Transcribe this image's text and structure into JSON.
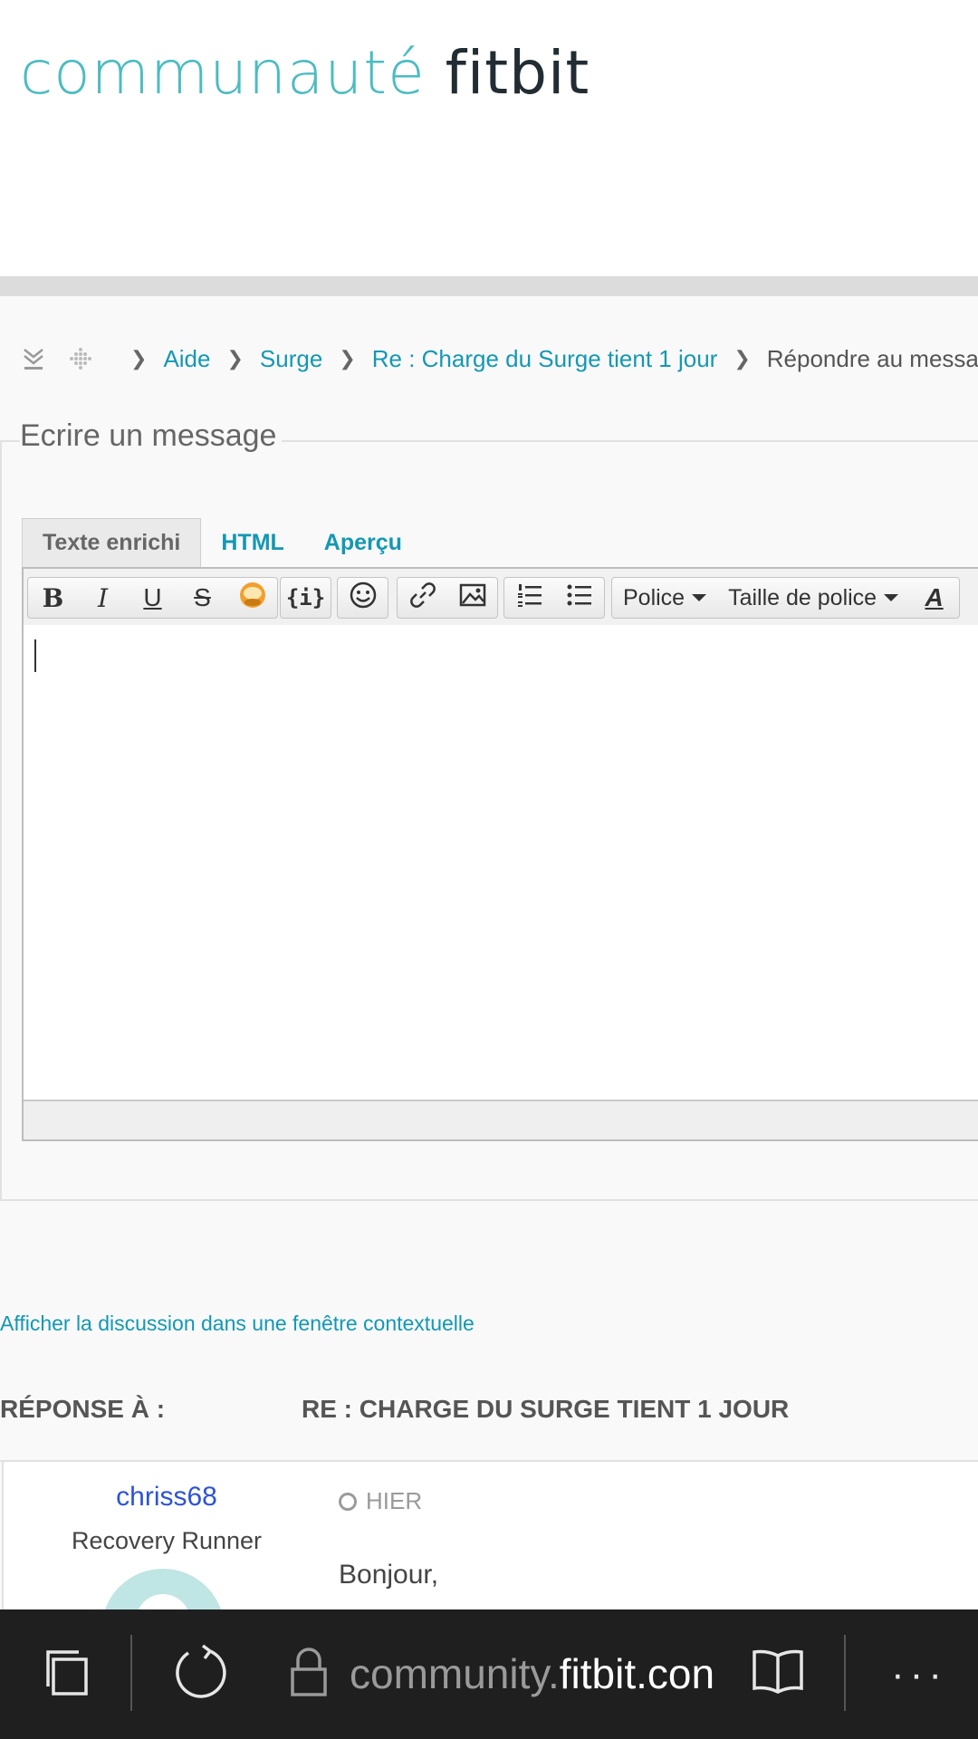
{
  "header": {
    "brand_left": "communauté",
    "brand_right": "fitbit"
  },
  "breadcrumb": {
    "items": [
      "Aide",
      "Surge",
      "Re : Charge du Surge tient 1 jour"
    ],
    "current": "Répondre au messag"
  },
  "form": {
    "legend": "Ecrire un message",
    "tabs": [
      "Texte enrichi",
      "HTML",
      "Aperçu"
    ],
    "active_tab": "Texte enrichi",
    "toolbar": {
      "bold": "B",
      "italic": "I",
      "underline": "U",
      "strikethrough": "S",
      "code": "{i}",
      "font_label": "Police",
      "font_size_label": "Taille de police",
      "text_color": "A"
    }
  },
  "thread": {
    "popup_link": "Afficher la discussion dans une fenêtre contextuelle",
    "reply_label": "RÉPONSE À :",
    "reply_subject": "RE : CHARGE DU SURGE TIENT 1 JOUR"
  },
  "post": {
    "author": "chriss68",
    "rank": "Recovery Runner",
    "time": "HIER",
    "body": "Bonjour,"
  },
  "browser": {
    "url_prefix": "community.",
    "url_host": "fitbit.con",
    "more": "···"
  },
  "colors": {
    "brand_teal": "#4bbcc1",
    "link": "#1498b3",
    "author": "#2d53d6",
    "browser_bar": "#1f1f1f"
  },
  "icons": [
    "collapse-icon",
    "grid-icon",
    "chevron-right-icon",
    "bold-icon",
    "italic-icon",
    "underline-icon",
    "strikethrough-icon",
    "spoiler-icon",
    "code-icon",
    "emoji-icon",
    "link-icon",
    "image-icon",
    "ordered-list-icon",
    "bullet-list-icon",
    "text-color-icon",
    "clock-icon",
    "tabs-icon",
    "refresh-icon",
    "lock-icon",
    "reading-view-icon",
    "more-icon"
  ]
}
